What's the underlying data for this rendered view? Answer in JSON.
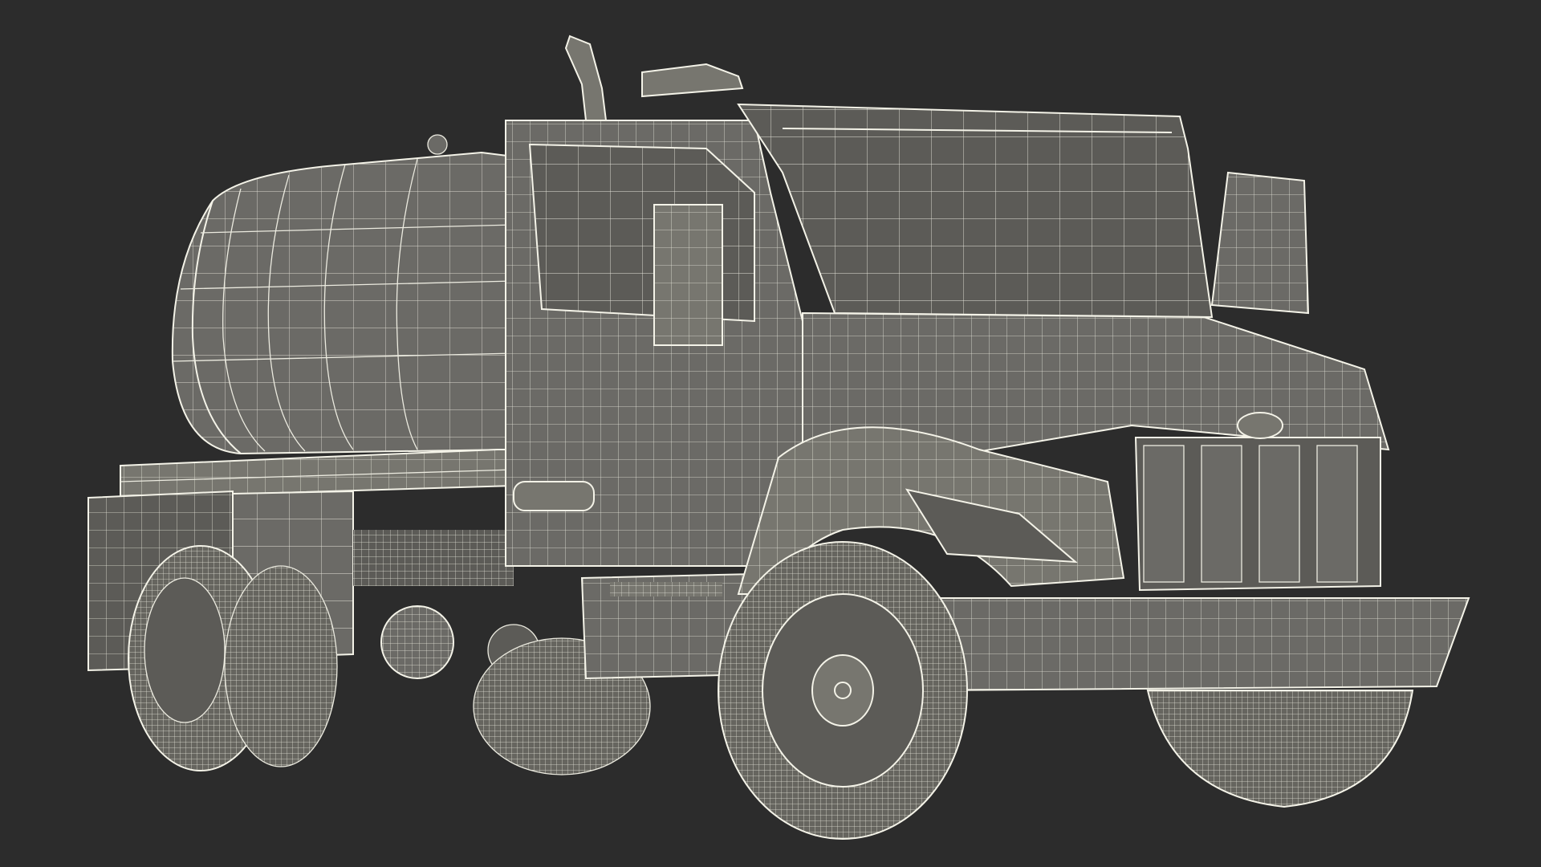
{
  "scene": {
    "subject": "vacuum-tanker-truck-wireframe",
    "background_color": "#2c2c2c",
    "model_fill_color": "#6b6a66",
    "wire_color": "#ecebe0"
  }
}
